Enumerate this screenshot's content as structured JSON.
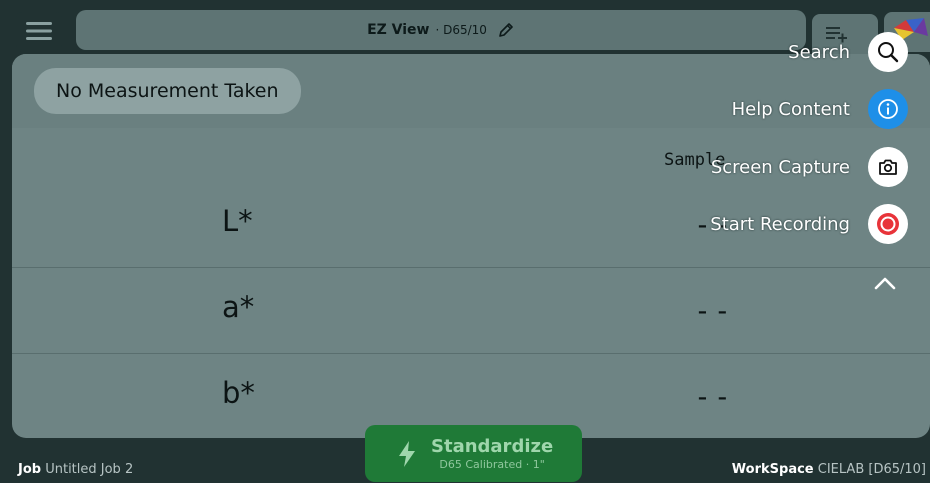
{
  "header": {
    "title": "EZ View",
    "subtitle": "· D65/10",
    "menu_icon": "hamburger-icon",
    "edit_icon": "pencil-icon",
    "add_icon": "list-add-icon",
    "logo_icon": "app-logo-icon"
  },
  "status": {
    "label": "No Measurement Taken"
  },
  "table": {
    "column_header": "Sample",
    "rows": [
      {
        "label": "L*",
        "value": "--"
      },
      {
        "label": "a*",
        "value": "--"
      },
      {
        "label": "b*",
        "value": "--"
      }
    ]
  },
  "quick_menu": {
    "items": [
      {
        "label": "Search",
        "icon": "search-icon"
      },
      {
        "label": "Help Content",
        "icon": "info-icon"
      },
      {
        "label": "Screen Capture",
        "icon": "camera-icon"
      },
      {
        "label": "Start Recording",
        "icon": "record-icon"
      }
    ],
    "collapse_icon": "chevron-up-icon"
  },
  "standardize": {
    "label": "Standardize",
    "sublabel": "D65 Calibrated · 1\""
  },
  "footer": {
    "job_label": "Job",
    "job_value": "Untitled Job 2",
    "workspace_label": "WorkSpace",
    "workspace_value": "CIELAB [D65/10]"
  },
  "colors": {
    "background": "#213232",
    "panel": "#6e8484",
    "accent_blue": "#1e8fe8",
    "standardize_green": "#1f7a37",
    "record_red": "#e8343a"
  }
}
